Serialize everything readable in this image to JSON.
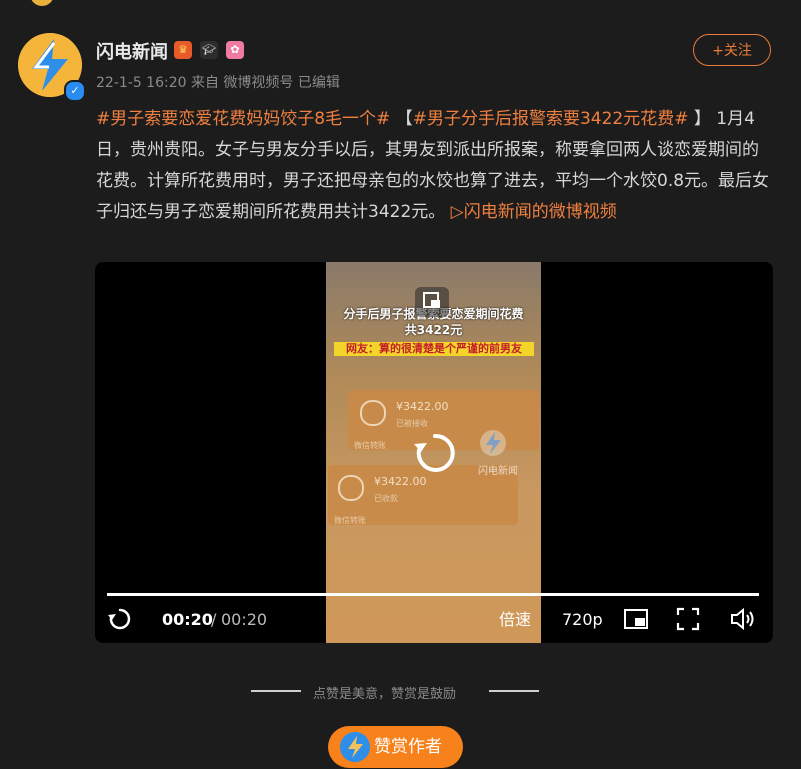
{
  "author": {
    "name": "闪电新闻",
    "verified": true,
    "badges": [
      "crown-badge-icon",
      "graduation-cap-badge-icon",
      "candy-badge-icon"
    ]
  },
  "post": {
    "meta": "22-1-5 16:20   来自 微博视频号 已编辑",
    "follow_label": "+关注",
    "hashtag1": "#男子索要恋爱花费妈妈饺子8毛一个#",
    "bracket_open": "【",
    "hashtag2": "#男子分手后报警索要3422元花费#",
    "bracket_close": "】",
    "body": "1月4日，贵州贵阳。女子与男友分手以后，其男友到派出所报案，称要拿回两人谈恋爱期间的花费。计算所花费用时，男子还把母亲包的水饺也算了进去，平均一个水饺0.8元。最后女子归还与男子恋爱期间所花费用共计3422元。",
    "video_link": "闪电新闻的微博视频"
  },
  "video": {
    "caption_line1": "分手后男子报警索要恋爱期间花费",
    "caption_line2": "共3422元",
    "caption_yellow": "网友：算的很清楚是个严谨的前男友",
    "card1_amount": "¥3422.00",
    "card1_status": "已被接收",
    "card1_footer": "微信转账",
    "card2_amount": "¥3422.00",
    "card2_status": "已收款",
    "card2_footer": "微信转账",
    "watermark": "闪电新闻",
    "time_current": "00:20",
    "time_separator": "/",
    "time_total": "00:20",
    "speed_label": "倍速",
    "quality_label": "720p",
    "progress": 1.0
  },
  "footer": {
    "divider_text": "点赞是美意，赞赏是鼓励",
    "reward_label": "赞赏作者"
  },
  "colors": {
    "background": "#1c1c1c",
    "accent": "#f08040",
    "reward_button": "#f7821c",
    "verified": "#2a8cf0"
  }
}
